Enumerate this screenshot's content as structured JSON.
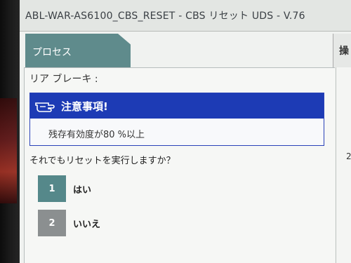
{
  "window": {
    "title": "ABL-WAR-AS6100_CBS_RESET - CBS リセット UDS - V.76"
  },
  "tabs": [
    {
      "label": "プロセス"
    },
    {
      "label": "操"
    }
  ],
  "content": {
    "section_label": "リア ブレーキ :",
    "caution": {
      "icon": "pointing-hand-icon",
      "title": "注意事項!",
      "body": "残存有効度が80 %以上"
    },
    "question": "それでもリセットを実行しますか？",
    "choices": [
      {
        "number": "1",
        "label": "はい"
      },
      {
        "number": "2",
        "label": "いいえ"
      }
    ]
  },
  "side_panel": {
    "value": "2"
  },
  "colors": {
    "tab_active": "#5f8b8c",
    "caution_header": "#1d3bb5",
    "choice_primary": "#55888a",
    "choice_secondary": "#8b8f90"
  }
}
